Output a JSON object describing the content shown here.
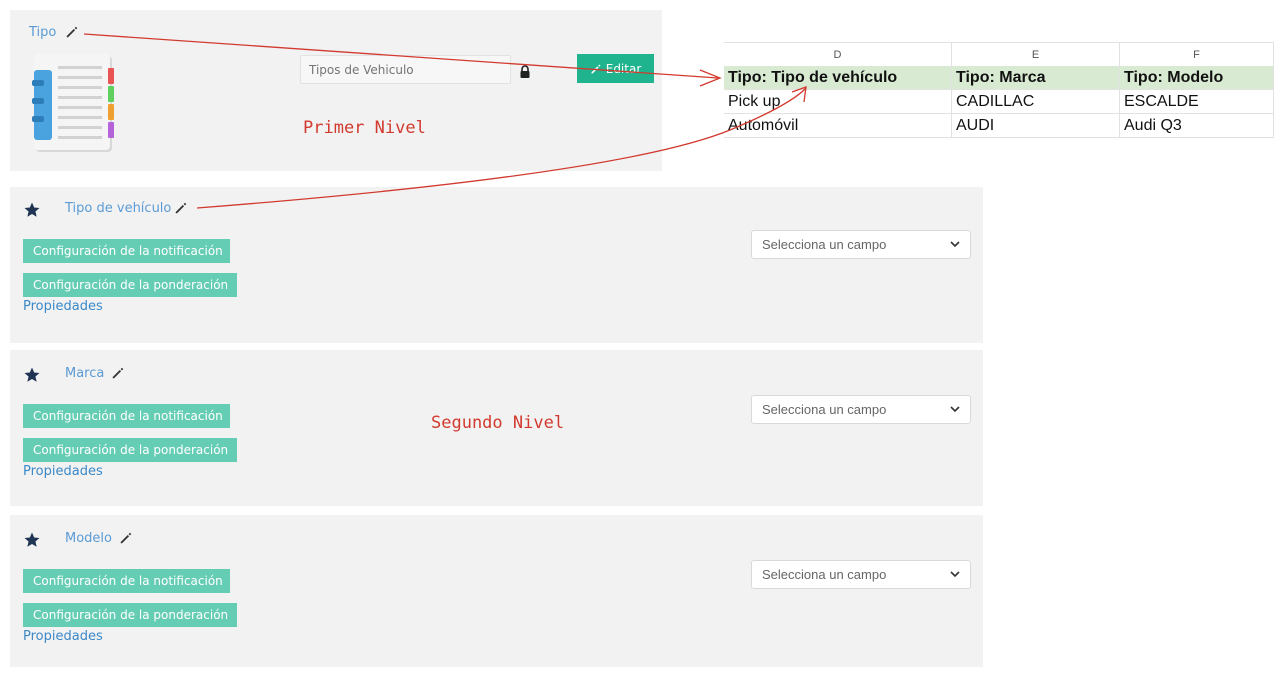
{
  "top_panel": {
    "title": "Tipo",
    "input_placeholder": "Tipos de Vehiculo",
    "edit_label": "Editar",
    "annotation": "Primer Nivel"
  },
  "spreadsheet": {
    "columns": [
      "D",
      "E",
      "F"
    ],
    "header": [
      "Tipo: Tipo de vehículo",
      "Tipo: Marca",
      "Tipo: Modelo"
    ],
    "rows": [
      [
        "Pick up",
        "CADILLAC",
        "ESCALDE"
      ],
      [
        "Automóvil",
        "AUDI",
        "Audi Q3"
      ]
    ]
  },
  "fields": [
    {
      "title": "Tipo de vehículo",
      "notif_label": "Configuración de la notificación",
      "ponder_label": "Configuración de la ponderación",
      "props_label": "Propiedades",
      "select_value": "Selecciona un campo"
    },
    {
      "title": "Marca",
      "notif_label": "Configuración de la notificación",
      "ponder_label": "Configuración de la ponderación",
      "props_label": "Propiedades",
      "select_value": "Selecciona un campo"
    },
    {
      "title": "Modelo",
      "notif_label": "Configuración de la notificación",
      "ponder_label": "Configuración de la ponderación",
      "props_label": "Propiedades",
      "select_value": "Selecciona un campo"
    }
  ],
  "annotation_second": "Segundo Nivel",
  "colors": {
    "accent_green": "#1fb48e",
    "teal_button": "#66cdb5",
    "link_blue": "#3a88c8",
    "annotation_red": "#d23a2f",
    "sheet_header": "#d9ead3"
  },
  "icons": [
    "pencil-icon",
    "notebook-icon",
    "lock-icon",
    "star-icon",
    "chevron-down-icon",
    "arrow-annotation"
  ]
}
